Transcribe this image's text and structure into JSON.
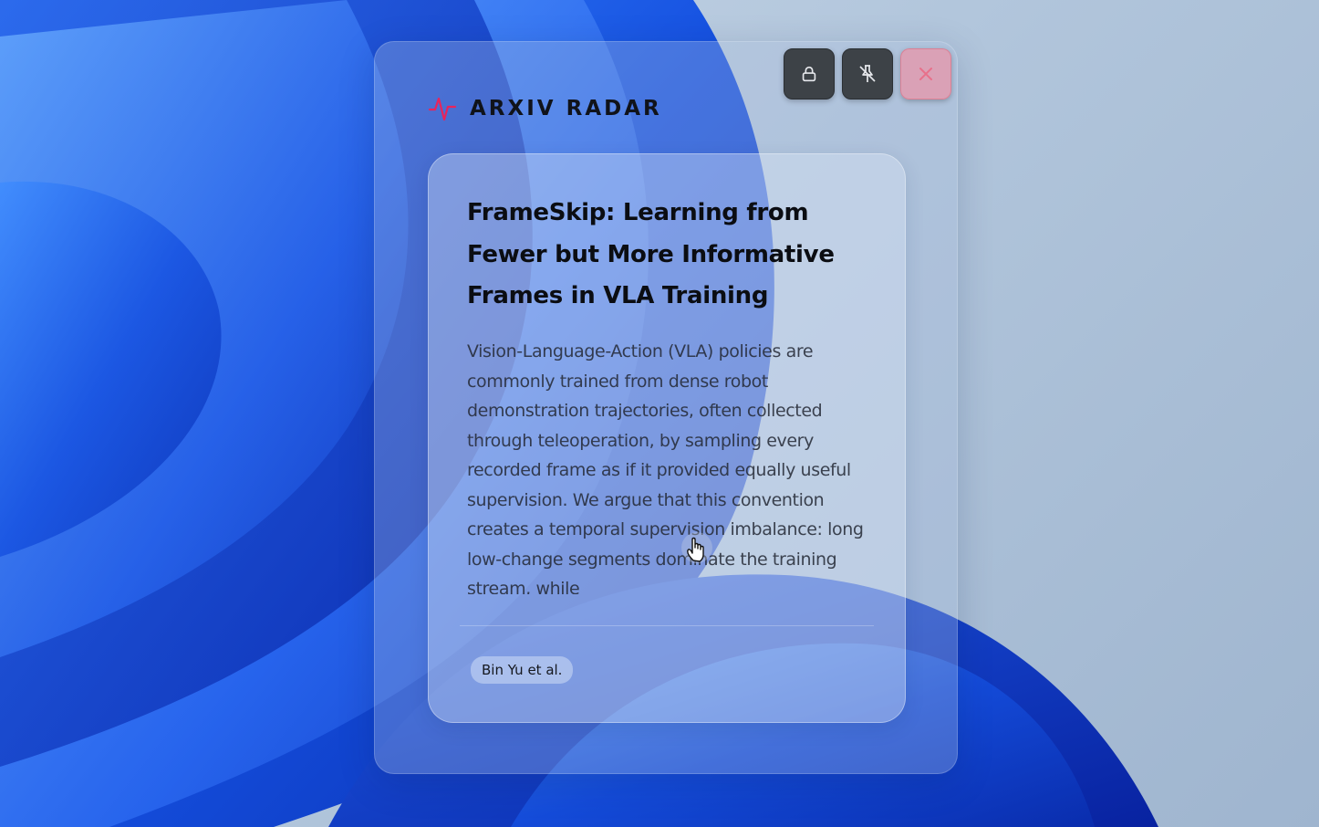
{
  "app": {
    "brand_name": "ARXIV RADAR",
    "brand_icon": "pulse-icon",
    "accent_color": "#e8245c"
  },
  "window_controls": {
    "lock": {
      "icon": "lock-icon"
    },
    "unpin": {
      "icon": "unpin-icon"
    },
    "close": {
      "icon": "close-icon",
      "color": "#e8708a"
    }
  },
  "paper": {
    "title": "FrameSkip: Learning from Fewer but More Informative Frames in VLA Training",
    "abstract": "Vision-Language-Action (VLA) policies are commonly trained from dense robot demonstration trajectories, often collected through teleoperation, by sampling every recorded frame as if it provided equally useful supervision. We argue that this convention creates a temporal supervision imbalance: long low-change segments dominate the training stream, while",
    "authors": "Bin Yu et al."
  },
  "pointer": {
    "icon": "hand-cursor-icon"
  }
}
